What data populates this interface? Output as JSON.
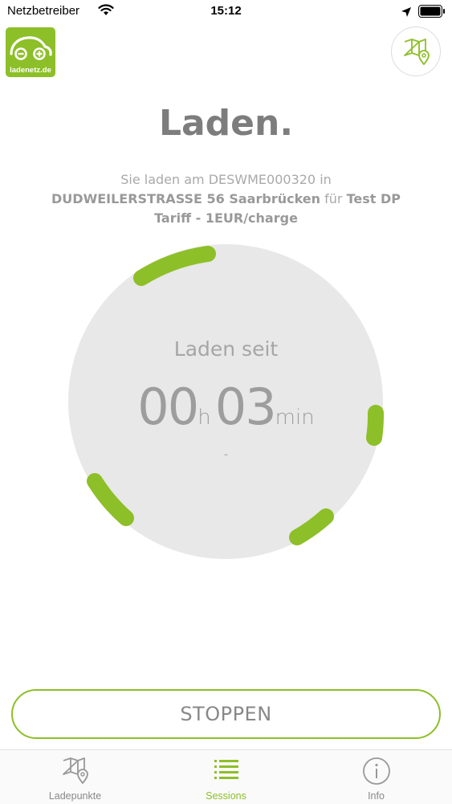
{
  "status_bar": {
    "carrier": "Netzbetreiber",
    "time": "15:12"
  },
  "logo": {
    "text": "ladenetz.de"
  },
  "page": {
    "title": "Laden.",
    "subtitle_prefix": "Sie laden am DESWME000320 in",
    "location": "DUDWEILERSTRASSE 56 Saarbrücken",
    "connector": "für",
    "tariff": "Test DP Tariff - 1EUR/charge"
  },
  "gauge": {
    "label": "Laden seit",
    "hours": "00",
    "hours_unit": "h",
    "minutes": "03",
    "minutes_unit": "min",
    "secondary": "-"
  },
  "actions": {
    "stop_label": "STOPPEN"
  },
  "tabs": [
    {
      "label": "Ladepunkte",
      "icon": "map-pin-icon"
    },
    {
      "label": "Sessions",
      "icon": "list-icon"
    },
    {
      "label": "Info",
      "icon": "info-icon"
    }
  ],
  "colors": {
    "accent": "#8dbf28",
    "text": "#7d7d7d",
    "circle": "#e8e8e8"
  }
}
